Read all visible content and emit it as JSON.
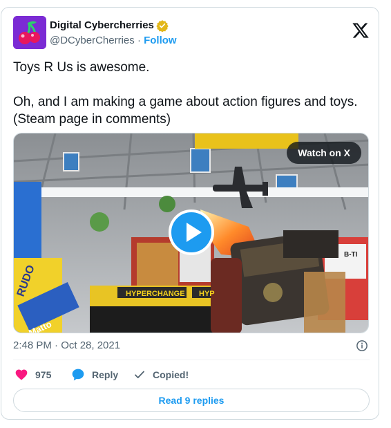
{
  "author": {
    "display_name": "Digital Cybercherries",
    "handle": "@DCyberCherries",
    "separator": "·",
    "follow_label": "Follow",
    "verified": true,
    "avatar_icon": "cherries-logo-icon"
  },
  "tweet": {
    "paragraphs": [
      "Toys R Us is awesome.",
      "Oh, and I am making a game about action figures and toys. (Steam page in comments)"
    ]
  },
  "media": {
    "watch_label": "Watch on X",
    "scene_text": {
      "sign": "HYPERCHANGE",
      "sign_partial": "HYP",
      "box_left": "RUDO",
      "box_blue": "Matto",
      "box_right": "B-TI"
    }
  },
  "timestamp": "2:48 PM · Oct 28, 2021",
  "actions": {
    "likes": "975",
    "reply_label": "Reply",
    "copied_label": "Copied!"
  },
  "read_replies_label": "Read 9 replies",
  "colors": {
    "accent": "#1d9bf0",
    "like": "#f91880",
    "verified_gold": "#e2b719",
    "avatar_bg": "#7b2bd4"
  }
}
